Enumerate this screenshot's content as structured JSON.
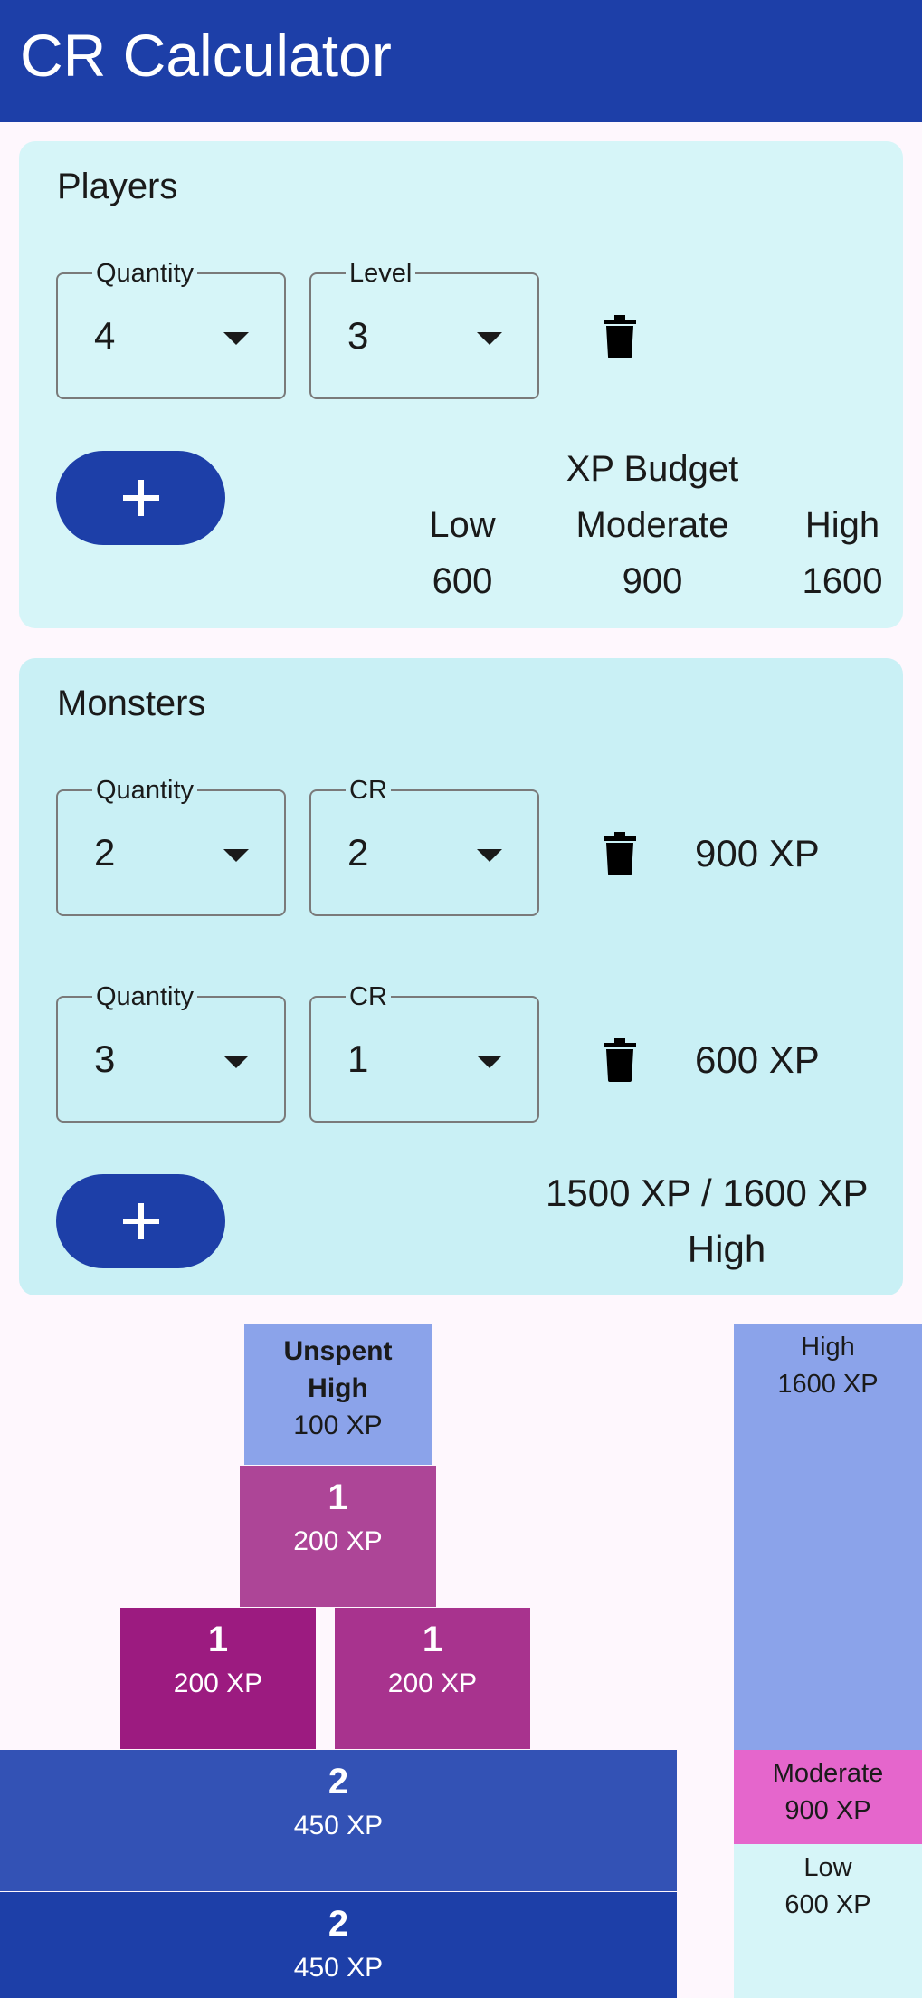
{
  "app": {
    "title": "CR Calculator"
  },
  "players": {
    "title": "Players",
    "quantity_label": "Quantity",
    "quantity_value": "4",
    "level_label": "Level",
    "level_value": "3",
    "budget": {
      "heading": "XP Budget",
      "low_label": "Low",
      "low_value": "600",
      "moderate_label": "Moderate",
      "moderate_value": "900",
      "high_label": "High",
      "high_value": "1600"
    }
  },
  "monsters": {
    "title": "Monsters",
    "rows": [
      {
        "quantity_label": "Quantity",
        "quantity_value": "2",
        "cr_label": "CR",
        "cr_value": "2",
        "xp": "900 XP"
      },
      {
        "quantity_label": "Quantity",
        "quantity_value": "3",
        "cr_label": "CR",
        "cr_value": "1",
        "xp": "600 XP"
      }
    ],
    "total_line": "1500 XP / 1600 XP",
    "difficulty": "High"
  },
  "pyramid": {
    "unspent": {
      "title": "Unspent",
      "subtitle": "High",
      "xp": "100 XP"
    },
    "cr1_a": {
      "count": "1",
      "xp": "200 XP"
    },
    "cr1_b": {
      "count": "1",
      "xp": "200 XP"
    },
    "cr1_c": {
      "count": "1",
      "xp": "200 XP"
    },
    "cr2_a": {
      "count": "2",
      "xp": "450 XP"
    },
    "cr2_b": {
      "count": "2",
      "xp": "450 XP"
    }
  },
  "scale": {
    "high_label": "High",
    "high_xp": "1600 XP",
    "moderate_label": "Moderate",
    "moderate_xp": "900 XP",
    "low_label": "Low",
    "low_xp": "600 XP"
  },
  "colors": {
    "primary": "#1d3fa8",
    "players_card": "#d6f5f8",
    "monsters_card": "#c9f0f5",
    "unspent": "#8ba3ea",
    "cr1_dark": "#9c1b80",
    "cr1_mid": "#a8338e",
    "cr1_light": "#ad4597",
    "cr2_light": "#3352b5",
    "cr2_dark": "#1d3fa8",
    "moderate": "#e566cc",
    "low": "#d6f5f8"
  }
}
